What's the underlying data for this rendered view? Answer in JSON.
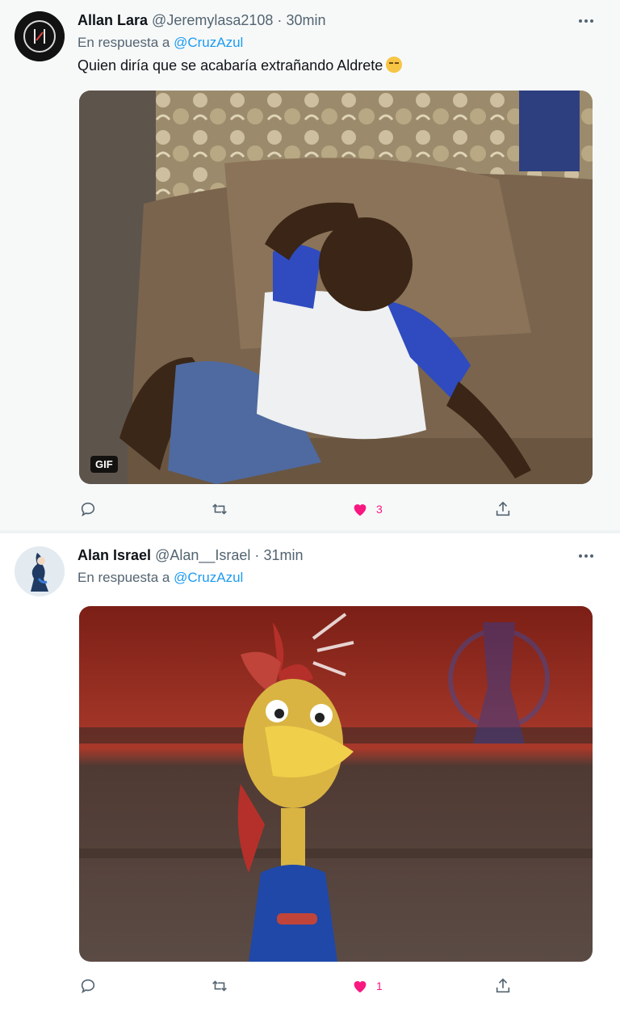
{
  "tweets": [
    {
      "name": "Allan Lara",
      "handle": "@Jeremylasa2108",
      "separator": "·",
      "time": "30min",
      "reply_prefix": "En respuesta a",
      "reply_to": "@CruzAzul",
      "text": "Quien diría que se acabaría extrañando Aldrete",
      "media_badge": "GIF",
      "like_count": "3"
    },
    {
      "name": "Alan Israel",
      "handle": "@Alan__Israel",
      "separator": "·",
      "time": "31min",
      "reply_prefix": "En respuesta a",
      "reply_to": "@CruzAzul",
      "like_count": "1"
    }
  ],
  "icons": {
    "reply": "reply-icon",
    "retweet": "retweet-icon",
    "like": "heart-icon",
    "share": "share-icon",
    "more": "more-icon"
  },
  "colors": {
    "like_active": "#f91880",
    "link": "#1d9bf0",
    "secondary_text": "#536471"
  }
}
